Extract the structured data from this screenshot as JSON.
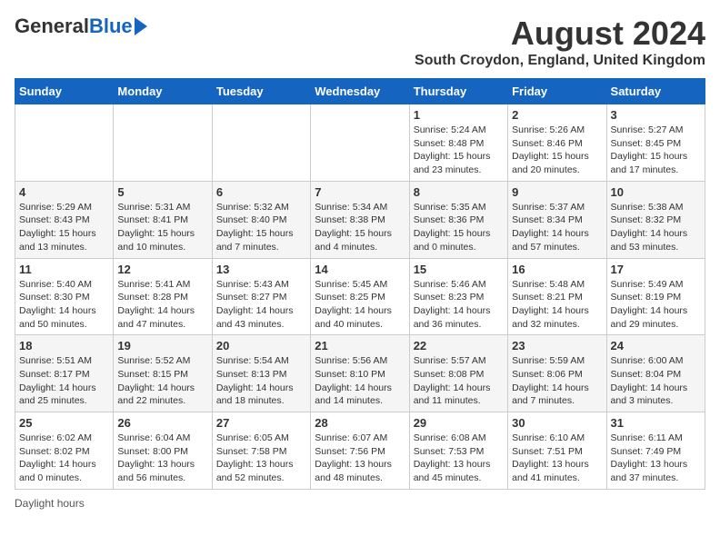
{
  "header": {
    "logo_general": "General",
    "logo_blue": "Blue",
    "month_title": "August 2024",
    "location": "South Croydon, England, United Kingdom"
  },
  "weekdays": [
    "Sunday",
    "Monday",
    "Tuesday",
    "Wednesday",
    "Thursday",
    "Friday",
    "Saturday"
  ],
  "footer": {
    "daylight_label": "Daylight hours"
  },
  "weeks": [
    [
      {
        "day": "",
        "info": ""
      },
      {
        "day": "",
        "info": ""
      },
      {
        "day": "",
        "info": ""
      },
      {
        "day": "",
        "info": ""
      },
      {
        "day": "1",
        "info": "Sunrise: 5:24 AM\nSunset: 8:48 PM\nDaylight: 15 hours and 23 minutes."
      },
      {
        "day": "2",
        "info": "Sunrise: 5:26 AM\nSunset: 8:46 PM\nDaylight: 15 hours and 20 minutes."
      },
      {
        "day": "3",
        "info": "Sunrise: 5:27 AM\nSunset: 8:45 PM\nDaylight: 15 hours and 17 minutes."
      }
    ],
    [
      {
        "day": "4",
        "info": "Sunrise: 5:29 AM\nSunset: 8:43 PM\nDaylight: 15 hours and 13 minutes."
      },
      {
        "day": "5",
        "info": "Sunrise: 5:31 AM\nSunset: 8:41 PM\nDaylight: 15 hours and 10 minutes."
      },
      {
        "day": "6",
        "info": "Sunrise: 5:32 AM\nSunset: 8:40 PM\nDaylight: 15 hours and 7 minutes."
      },
      {
        "day": "7",
        "info": "Sunrise: 5:34 AM\nSunset: 8:38 PM\nDaylight: 15 hours and 4 minutes."
      },
      {
        "day": "8",
        "info": "Sunrise: 5:35 AM\nSunset: 8:36 PM\nDaylight: 15 hours and 0 minutes."
      },
      {
        "day": "9",
        "info": "Sunrise: 5:37 AM\nSunset: 8:34 PM\nDaylight: 14 hours and 57 minutes."
      },
      {
        "day": "10",
        "info": "Sunrise: 5:38 AM\nSunset: 8:32 PM\nDaylight: 14 hours and 53 minutes."
      }
    ],
    [
      {
        "day": "11",
        "info": "Sunrise: 5:40 AM\nSunset: 8:30 PM\nDaylight: 14 hours and 50 minutes."
      },
      {
        "day": "12",
        "info": "Sunrise: 5:41 AM\nSunset: 8:28 PM\nDaylight: 14 hours and 47 minutes."
      },
      {
        "day": "13",
        "info": "Sunrise: 5:43 AM\nSunset: 8:27 PM\nDaylight: 14 hours and 43 minutes."
      },
      {
        "day": "14",
        "info": "Sunrise: 5:45 AM\nSunset: 8:25 PM\nDaylight: 14 hours and 40 minutes."
      },
      {
        "day": "15",
        "info": "Sunrise: 5:46 AM\nSunset: 8:23 PM\nDaylight: 14 hours and 36 minutes."
      },
      {
        "day": "16",
        "info": "Sunrise: 5:48 AM\nSunset: 8:21 PM\nDaylight: 14 hours and 32 minutes."
      },
      {
        "day": "17",
        "info": "Sunrise: 5:49 AM\nSunset: 8:19 PM\nDaylight: 14 hours and 29 minutes."
      }
    ],
    [
      {
        "day": "18",
        "info": "Sunrise: 5:51 AM\nSunset: 8:17 PM\nDaylight: 14 hours and 25 minutes."
      },
      {
        "day": "19",
        "info": "Sunrise: 5:52 AM\nSunset: 8:15 PM\nDaylight: 14 hours and 22 minutes."
      },
      {
        "day": "20",
        "info": "Sunrise: 5:54 AM\nSunset: 8:13 PM\nDaylight: 14 hours and 18 minutes."
      },
      {
        "day": "21",
        "info": "Sunrise: 5:56 AM\nSunset: 8:10 PM\nDaylight: 14 hours and 14 minutes."
      },
      {
        "day": "22",
        "info": "Sunrise: 5:57 AM\nSunset: 8:08 PM\nDaylight: 14 hours and 11 minutes."
      },
      {
        "day": "23",
        "info": "Sunrise: 5:59 AM\nSunset: 8:06 PM\nDaylight: 14 hours and 7 minutes."
      },
      {
        "day": "24",
        "info": "Sunrise: 6:00 AM\nSunset: 8:04 PM\nDaylight: 14 hours and 3 minutes."
      }
    ],
    [
      {
        "day": "25",
        "info": "Sunrise: 6:02 AM\nSunset: 8:02 PM\nDaylight: 14 hours and 0 minutes."
      },
      {
        "day": "26",
        "info": "Sunrise: 6:04 AM\nSunset: 8:00 PM\nDaylight: 13 hours and 56 minutes."
      },
      {
        "day": "27",
        "info": "Sunrise: 6:05 AM\nSunset: 7:58 PM\nDaylight: 13 hours and 52 minutes."
      },
      {
        "day": "28",
        "info": "Sunrise: 6:07 AM\nSunset: 7:56 PM\nDaylight: 13 hours and 48 minutes."
      },
      {
        "day": "29",
        "info": "Sunrise: 6:08 AM\nSunset: 7:53 PM\nDaylight: 13 hours and 45 minutes."
      },
      {
        "day": "30",
        "info": "Sunrise: 6:10 AM\nSunset: 7:51 PM\nDaylight: 13 hours and 41 minutes."
      },
      {
        "day": "31",
        "info": "Sunrise: 6:11 AM\nSunset: 7:49 PM\nDaylight: 13 hours and 37 minutes."
      }
    ]
  ]
}
